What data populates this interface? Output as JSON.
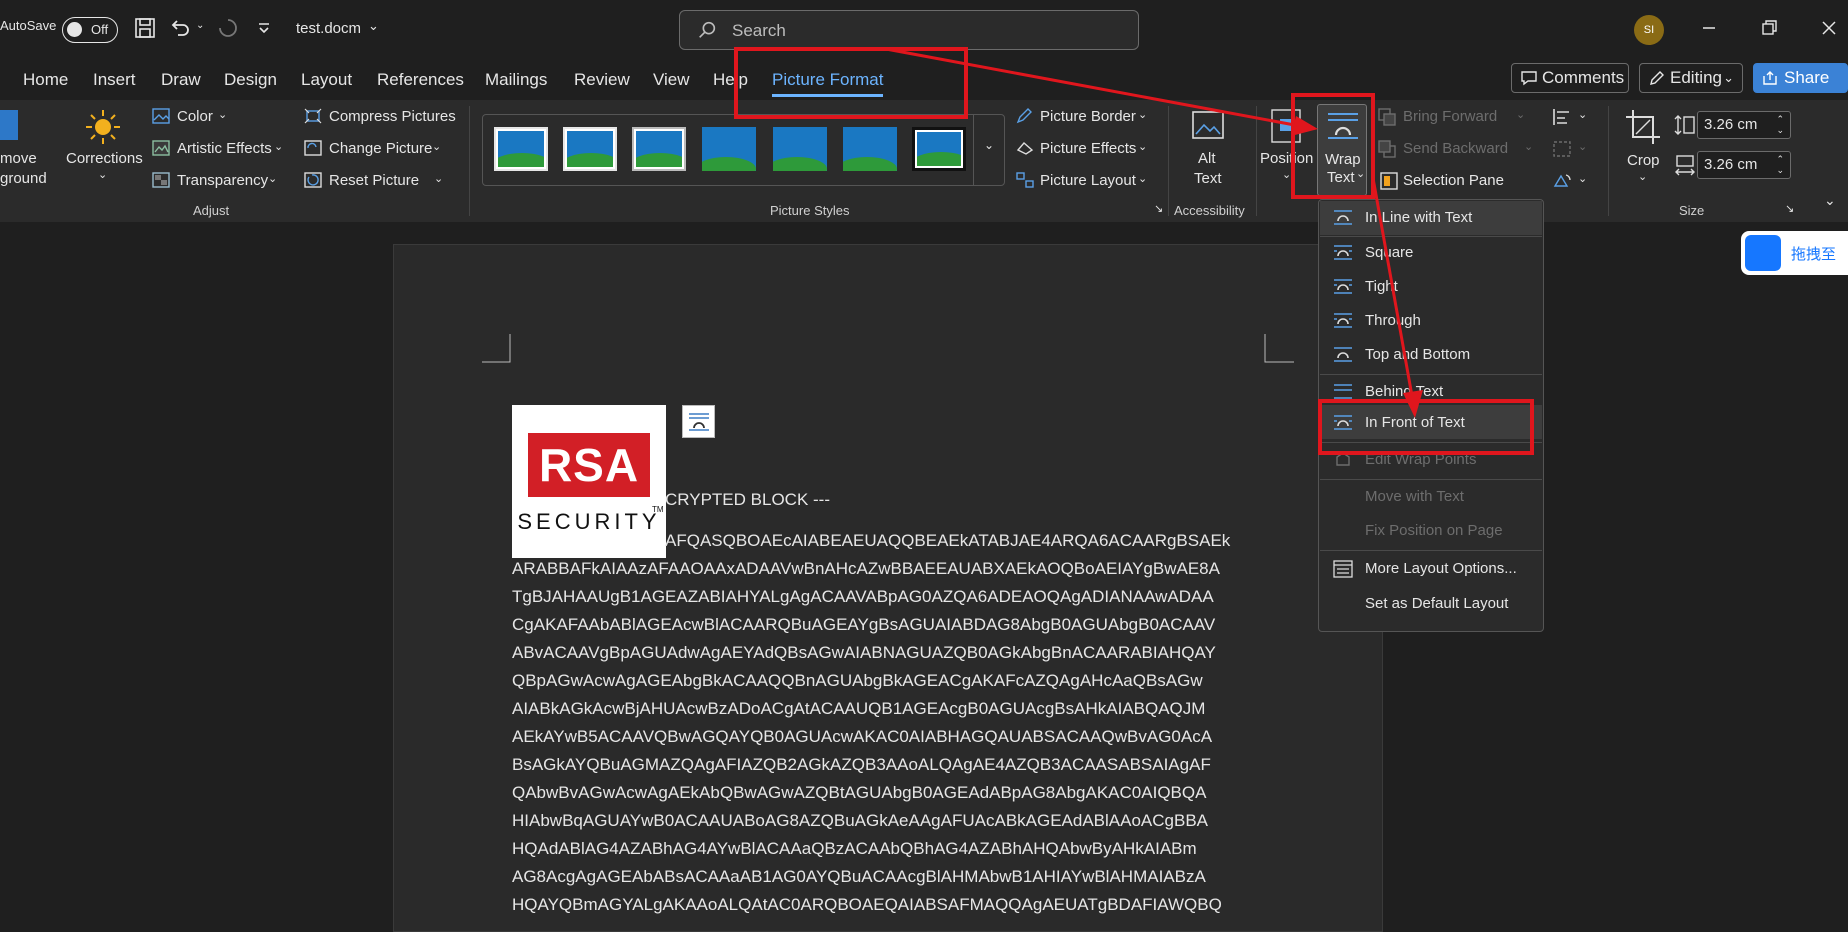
{
  "titlebar": {
    "autosave_label": "AutoSave",
    "autosave_state": "Off",
    "filename": "test.docm",
    "search_placeholder": "Search",
    "avatar_initials": "SI"
  },
  "tabs": [
    "Home",
    "Insert",
    "Draw",
    "Design",
    "Layout",
    "References",
    "Mailings",
    "Review",
    "View",
    "Help",
    "Picture Format"
  ],
  "active_tab": "Picture Format",
  "ribbon_right": {
    "comments": "Comments",
    "editing": "Editing",
    "share": "Share"
  },
  "ribbon": {
    "remove_bg_line1": "move",
    "remove_bg_line2": "ground",
    "corrections": "Corrections",
    "color": "Color",
    "artistic_effects": "Artistic Effects",
    "transparency": "Transparency",
    "compress": "Compress Pictures",
    "change": "Change Picture",
    "reset": "Reset Picture",
    "adjust_label": "Adjust",
    "picture_border": "Picture Border",
    "picture_effects": "Picture Effects",
    "picture_layout": "Picture Layout",
    "picture_styles_label": "Picture Styles",
    "alt_text_line1": "Alt",
    "alt_text_line2": "Text",
    "accessibility_label": "Accessibility",
    "position": "Position",
    "wrap_line1": "Wrap",
    "wrap_line2": "Text",
    "bring_forward": "Bring Forward",
    "send_backward": "Send Backward",
    "selection_pane": "Selection Pane",
    "crop": "Crop",
    "height_value": "3.26 cm",
    "width_value": "3.26 cm",
    "size_label": "Size"
  },
  "wrap_menu": {
    "items": [
      "In Line with Text",
      "Square",
      "Tight",
      "Through",
      "Top and Bottom",
      "Behind Text",
      "In Front of Text"
    ],
    "edit_wrap_points": "Edit Wrap Points",
    "move_with_text": "Move with Text",
    "fix_position": "Fix Position on Page",
    "more_layout": "More Layout Options...",
    "set_default": "Set as Default Layout"
  },
  "logo": {
    "brand": "RSA",
    "tagline": "SECURITY",
    "tm": "TM"
  },
  "document": {
    "lines": [
      "CRYPTED BLOCK ---",
      "AFQASQBOAEcAIABEAEUAQQBEAEkATABJAE4ARQA6ACAARgBSAEk",
      "ARABBAFkAIAAzAFAAOAAxADAAVwBnAHcAZwBBAEEAUABXAEkAOQBoAEIAYgBwAE8A",
      "TgBJAHAAUgB1AGEAZABIAHYALgAgACAAVABpAG0AZQA6ADEAOQAgADIANAAwADAA",
      "CgAKAFAAbABlAGEAcwBlACAARQBuAGEAYgBsAGUAIABDAG8AbgB0AGUAbgB0ACAAV",
      "ABvACAAVgBpAGUAdwAgAEYAdQBsAGwAIABNAGUAZQB0AGkAbgBnACAARABIAHQAY",
      "QBpAGwAcwAgAGEAbgBkACAAQQBnAGUAbgBkAGEACgAKAFcAZQAgAHcAaQBsAGw",
      "AIABkAGkAcwBjAHUAcwBzADoACgAtACAAUQB1AGEAcgB0AGUAcgBsAHkAIABQAQJM",
      "AEkAYwB5ACAAVQBwAGQAYQB0AGUAcwAKAC0AIABHAGQAUABSACAAQwBvAG0AcA",
      "BsAGkAYQBuAGMAZQAgAFIAZQB2AGkAZQB3AAoALQAgAE4AZQB3ACAASABSAIAgAF",
      "QAbwBvAGwAcwAgAEkAbQBwAGwAZQBtAGUAbgB0AGEAdABpAG8AbgAKAC0AIQBQA",
      "HIAbwBqAGUAYwB0ACAAUABoAG8AZQBuAGkAeAAgAFUAcABkAGEAdABlAAoACgBBA",
      "HQAdABlAG4AZABhAG4AYwBlACAAaQBzACAAbQBhAG4AZABhAHQAbwByAHkAIABm",
      "AG8AcgAgAGEAbABsACAAaAB1AG0AYQBuACAAcgBlAHMAbwB1AHIAYwBlAHMAIABzA",
      "HQAYQBmAGYALgAKAAoALQAtAC0ARQBOAEQAIABSAFMAQQAgAEUATgBDAFIAWQBQ"
    ]
  },
  "side_badge": "拖拽至"
}
